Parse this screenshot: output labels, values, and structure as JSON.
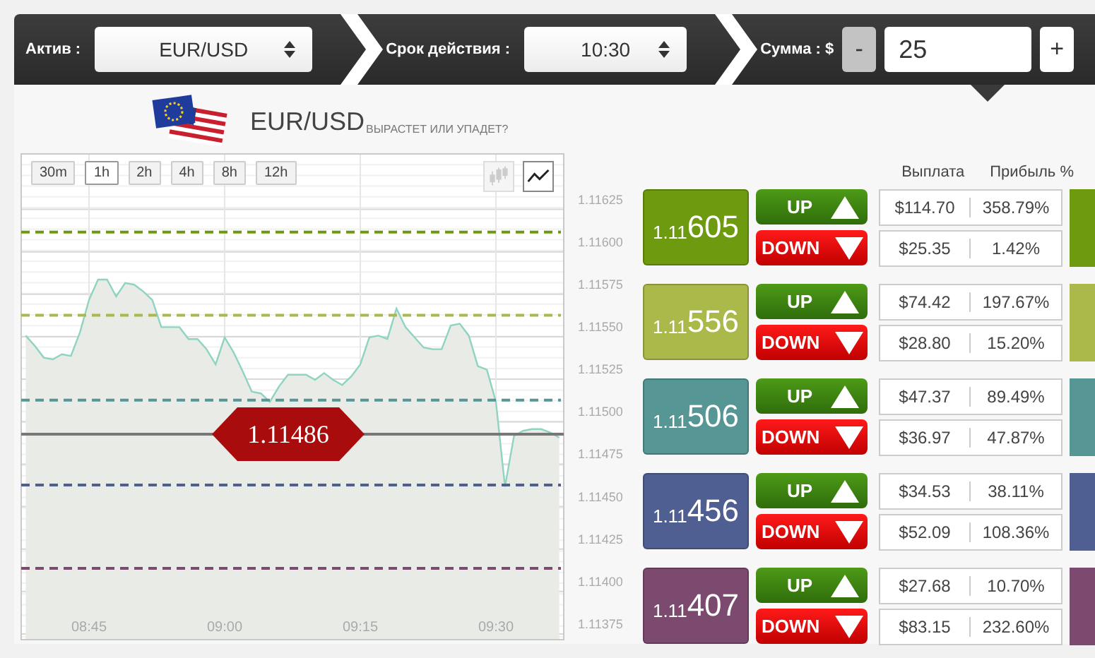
{
  "top_bar": {
    "asset": {
      "label": "Актив :",
      "value": "EUR/USD"
    },
    "expiry": {
      "label": "Срок действия :",
      "value": "10:30"
    },
    "amount": {
      "label": "Сумма : $",
      "decrement": "-",
      "decrement_disabled": true,
      "value": "25",
      "increment": "+"
    }
  },
  "heading": {
    "asset": "EUR/USD",
    "question": "ВЫРАСТЕТ ИЛИ УПАДЕТ?"
  },
  "chart": {
    "timeframes": [
      {
        "label": "30m",
        "selected": false
      },
      {
        "label": "1h",
        "selected": true
      },
      {
        "label": "2h",
        "selected": false
      },
      {
        "label": "4h",
        "selected": false
      },
      {
        "label": "8h",
        "selected": false
      },
      {
        "label": "12h",
        "selected": false
      }
    ],
    "chart_types": [
      {
        "kind": "candles",
        "selected": false
      },
      {
        "kind": "line",
        "selected": true
      }
    ],
    "current_price": "1.11486",
    "chart_data": {
      "type": "area",
      "grid": true,
      "categories": [
        null,
        null,
        null,
        null,
        null,
        null,
        null,
        "08:45",
        null,
        null,
        null,
        null,
        null,
        null,
        null,
        null,
        null,
        null,
        null,
        null,
        null,
        null,
        "09:00",
        null,
        null,
        null,
        null,
        null,
        null,
        null,
        null,
        null,
        null,
        null,
        null,
        null,
        null,
        "09:15",
        null,
        null,
        null,
        null,
        null,
        null,
        null,
        null,
        null,
        null,
        null,
        null,
        null,
        null,
        "09:30",
        null,
        null,
        null,
        null,
        null,
        null,
        null
      ],
      "series": [
        {
          "color": "#8fd3c1",
          "values": [
            1.11544,
            1.11538,
            1.11531,
            1.1153,
            1.11533,
            1.11532,
            1.11546,
            1.11565,
            1.11577,
            1.11577,
            1.11567,
            1.11575,
            1.11574,
            1.1157,
            1.11565,
            1.11549,
            1.11549,
            1.11549,
            1.11542,
            1.11542,
            1.11536,
            1.11527,
            1.11543,
            1.11534,
            1.11523,
            1.11511,
            1.1151,
            1.11505,
            1.11514,
            1.11521,
            1.11521,
            1.11521,
            1.11518,
            1.11522,
            1.11518,
            1.11515,
            1.1152,
            1.11527,
            1.11543,
            1.11544,
            1.11542,
            1.1156,
            1.11549,
            1.11543,
            1.11537,
            1.11536,
            1.11536,
            1.1155,
            1.11551,
            1.11544,
            1.11526,
            1.11524,
            1.11505,
            1.11455,
            1.11485,
            1.11488,
            1.11489,
            1.11489,
            1.11487,
            1.11484
          ]
        }
      ],
      "ylim": [
        1.11365,
        1.11651
      ],
      "yticks": [
        {
          "value": 1.11625,
          "label": "1.11625"
        },
        {
          "value": 1.116,
          "label": "1.11600"
        },
        {
          "value": 1.11575,
          "label": "1.11575"
        },
        {
          "value": 1.1155,
          "label": "1.11550"
        },
        {
          "value": 1.11525,
          "label": "1.11525"
        },
        {
          "value": 1.115,
          "label": "1.11500"
        },
        {
          "value": 1.11475,
          "label": "1.11475"
        },
        {
          "value": 1.1145,
          "label": "1.11450"
        },
        {
          "value": 1.11425,
          "label": "1.11425"
        },
        {
          "value": 1.114,
          "label": "1.11400"
        },
        {
          "value": 1.11375,
          "label": "1.11375"
        }
      ]
    }
  },
  "columns": {
    "payout": "Выплата",
    "profit": "Прибыль %"
  },
  "strikes": [
    {
      "price": "1.11605",
      "color": "#6e9a0f",
      "up": {
        "label": "UP",
        "payout": "$114.70",
        "profit": "358.79%"
      },
      "down": {
        "label": "DOWN",
        "payout": "$25.35",
        "profit": "1.42%"
      }
    },
    {
      "price": "1.11556",
      "color": "#abb84a",
      "up": {
        "label": "UP",
        "payout": "$74.42",
        "profit": "197.67%"
      },
      "down": {
        "label": "DOWN",
        "payout": "$28.80",
        "profit": "15.20%"
      }
    },
    {
      "price": "1.11506",
      "color": "#569795",
      "up": {
        "label": "UP",
        "payout": "$47.37",
        "profit": "89.49%"
      },
      "down": {
        "label": "DOWN",
        "payout": "$36.97",
        "profit": "47.87%"
      }
    },
    {
      "price": "1.11456",
      "color": "#4f5f91",
      "up": {
        "label": "UP",
        "payout": "$34.53",
        "profit": "38.11%"
      },
      "down": {
        "label": "DOWN",
        "payout": "$52.09",
        "profit": "108.36%"
      }
    },
    {
      "price": "1.11407",
      "color": "#7c4a6f",
      "up": {
        "label": "UP",
        "payout": "$27.68",
        "profit": "10.70%"
      },
      "down": {
        "label": "DOWN",
        "payout": "$83.15",
        "profit": "232.60%"
      }
    }
  ]
}
